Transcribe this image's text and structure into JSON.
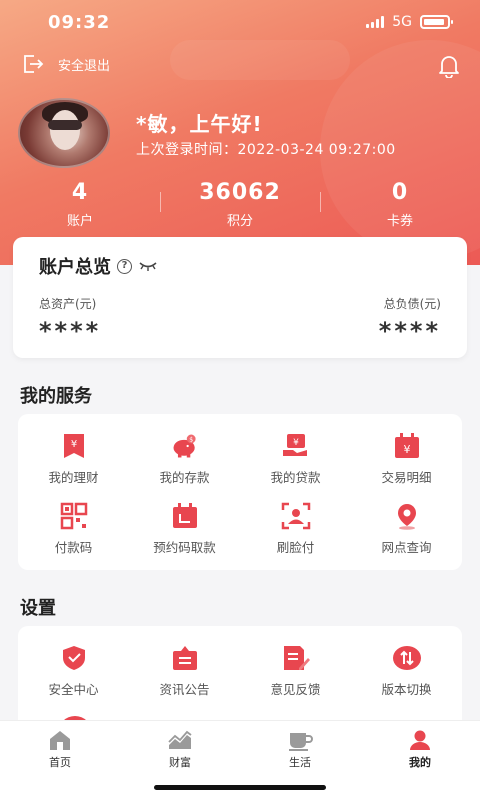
{
  "status_bar": {
    "time": "09:32",
    "network": "5G"
  },
  "header": {
    "logout_label": "安全退出",
    "greeting": "*敏，上午好!",
    "last_login": "上次登录时间：2022-03-24 09:27:00"
  },
  "stats": [
    {
      "value": "4",
      "label": "账户"
    },
    {
      "value": "36062",
      "label": "积分"
    },
    {
      "value": "0",
      "label": "卡券"
    }
  ],
  "overview": {
    "title": "账户总览",
    "help": "?",
    "assets_label": "总资产(元)",
    "assets_value": "****",
    "liabilities_label": "总负债(元)",
    "liabilities_value": "****"
  },
  "services": {
    "title": "我的服务",
    "items": [
      {
        "label": "我的理财",
        "icon": "wealth-icon"
      },
      {
        "label": "我的存款",
        "icon": "piggy-bank-icon"
      },
      {
        "label": "我的贷款",
        "icon": "loan-icon"
      },
      {
        "label": "交易明细",
        "icon": "calendar-yen-icon"
      },
      {
        "label": "付款码",
        "icon": "qr-code-icon"
      },
      {
        "label": "预约码取款",
        "icon": "calendar-withdraw-icon"
      },
      {
        "label": "刷脸付",
        "icon": "face-scan-icon"
      },
      {
        "label": "网点查询",
        "icon": "location-pin-icon"
      }
    ]
  },
  "settings": {
    "title": "设置",
    "items": [
      {
        "label": "安全中心",
        "icon": "shield-icon"
      },
      {
        "label": "资讯公告",
        "icon": "announcement-icon"
      },
      {
        "label": "意见反馈",
        "icon": "feedback-icon"
      },
      {
        "label": "版本切换",
        "icon": "switch-icon"
      }
    ]
  },
  "tabbar": [
    {
      "label": "首页",
      "icon": "home-icon",
      "active": false
    },
    {
      "label": "财富",
      "icon": "chart-icon",
      "active": false
    },
    {
      "label": "生活",
      "icon": "cup-icon",
      "active": false
    },
    {
      "label": "我的",
      "icon": "user-icon",
      "active": true
    }
  ],
  "colors": {
    "accent": "#e8464f",
    "hero_start": "#f6a985",
    "hero_end": "#ec5a55"
  }
}
